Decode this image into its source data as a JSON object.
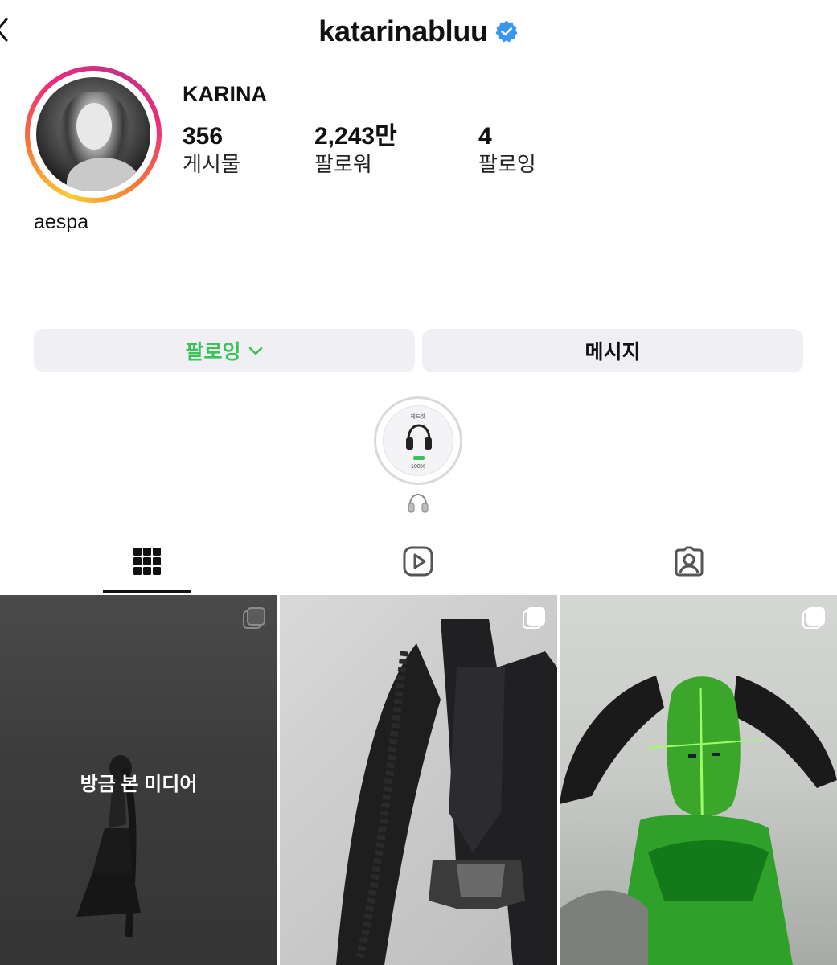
{
  "header": {
    "username": "katarinabluu",
    "verified": true,
    "accent_color": "#3897f0"
  },
  "profile": {
    "display_name": "KARINA",
    "bio": "aespa",
    "stats": [
      {
        "value": "356",
        "label": "게시물"
      },
      {
        "value": "2,243만",
        "label": "팔로워"
      },
      {
        "value": "4",
        "label": "팔로잉"
      }
    ]
  },
  "actions": {
    "following_label": "팔로잉",
    "following_color": "#3bc25b",
    "message_label": "메시지"
  },
  "highlight": {
    "cover_title": "헤드셋",
    "cover_battery": "100%",
    "icon": "headphones-icon"
  },
  "tabs": [
    {
      "icon": "grid-icon",
      "active": true
    },
    {
      "icon": "reels-icon",
      "active": false
    },
    {
      "icon": "tagged-icon",
      "active": false
    }
  ],
  "posts": [
    {
      "overlay_text": "방금 본 미디어",
      "multi": true
    },
    {
      "overlay_text": "",
      "multi": true
    },
    {
      "overlay_text": "",
      "multi": true
    }
  ]
}
